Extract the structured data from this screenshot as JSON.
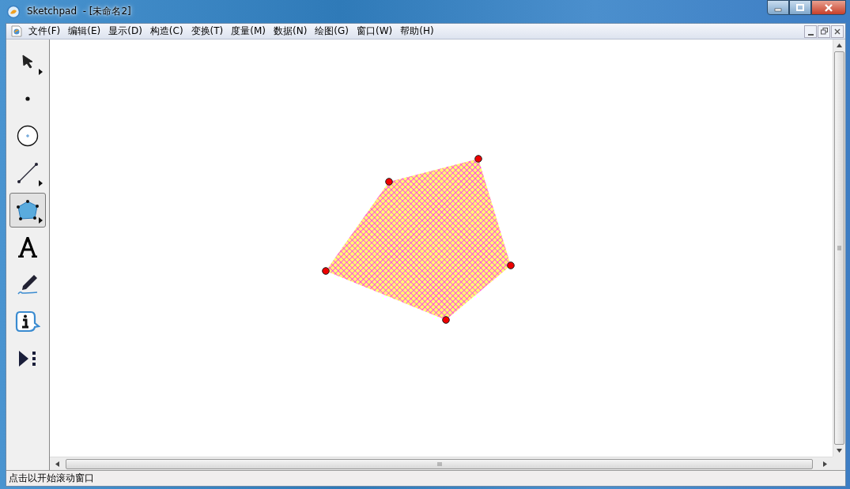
{
  "window": {
    "title": "Sketchpad  - [未命名2]"
  },
  "menu": [
    "文件(F)",
    "编辑(E)",
    "显示(D)",
    "构造(C)",
    "变换(T)",
    "度量(M)",
    "数据(N)",
    "绘图(G)",
    "窗口(W)",
    "帮助(H)"
  ],
  "tools": [
    {
      "kind": "arrow",
      "selected": false,
      "submenu": true
    },
    {
      "kind": "point",
      "selected": false,
      "submenu": false
    },
    {
      "kind": "compass",
      "selected": false,
      "submenu": false
    },
    {
      "kind": "line",
      "selected": false,
      "submenu": true
    },
    {
      "kind": "polygon",
      "selected": true,
      "submenu": true
    },
    {
      "kind": "text",
      "selected": false,
      "submenu": false
    },
    {
      "kind": "marker",
      "selected": false,
      "submenu": false
    },
    {
      "kind": "info",
      "selected": false,
      "submenu": false
    },
    {
      "kind": "custom",
      "selected": false,
      "submenu": false
    }
  ],
  "status_bar": {
    "text": "点击以开始滚动窗口"
  }
}
